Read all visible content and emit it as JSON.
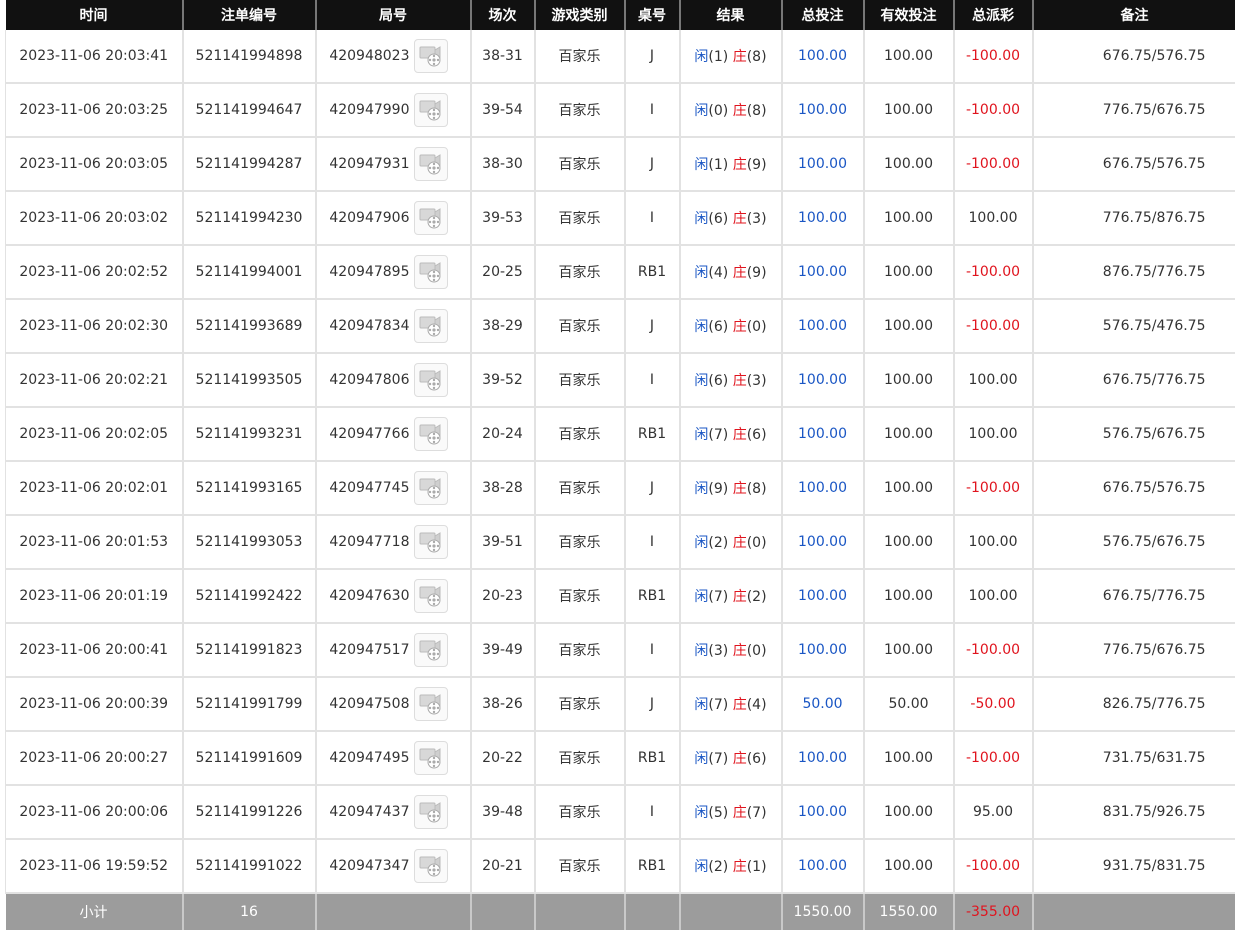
{
  "headers": {
    "time": "时间",
    "order_no": "注单编号",
    "round_no": "局号",
    "session": "场次",
    "game_type": "游戏类别",
    "table": "桌号",
    "result": "结果",
    "total_bet": "总投注",
    "valid_bet": "有效投注",
    "payout": "总派彩",
    "remark": "备注"
  },
  "result_labels": {
    "player": "闲",
    "banker": "庄"
  },
  "rows": [
    {
      "time": "2023-11-06 20:03:41",
      "order": "521141994898",
      "round": "420948023",
      "session": "38-31",
      "game": "百家乐",
      "table": "J",
      "player": "(1)",
      "banker": "(8)",
      "total": "100.00",
      "valid": "100.00",
      "payout": "-100.00",
      "neg": true,
      "remark": "676.75/576.75"
    },
    {
      "time": "2023-11-06 20:03:25",
      "order": "521141994647",
      "round": "420947990",
      "session": "39-54",
      "game": "百家乐",
      "table": "I",
      "player": "(0)",
      "banker": "(8)",
      "total": "100.00",
      "valid": "100.00",
      "payout": "-100.00",
      "neg": true,
      "remark": "776.75/676.75"
    },
    {
      "time": "2023-11-06 20:03:05",
      "order": "521141994287",
      "round": "420947931",
      "session": "38-30",
      "game": "百家乐",
      "table": "J",
      "player": "(1)",
      "banker": "(9)",
      "total": "100.00",
      "valid": "100.00",
      "payout": "-100.00",
      "neg": true,
      "remark": "676.75/576.75"
    },
    {
      "time": "2023-11-06 20:03:02",
      "order": "521141994230",
      "round": "420947906",
      "session": "39-53",
      "game": "百家乐",
      "table": "I",
      "player": "(6)",
      "banker": "(3)",
      "total": "100.00",
      "valid": "100.00",
      "payout": "100.00",
      "neg": false,
      "remark": "776.75/876.75"
    },
    {
      "time": "2023-11-06 20:02:52",
      "order": "521141994001",
      "round": "420947895",
      "session": "20-25",
      "game": "百家乐",
      "table": "RB1",
      "player": "(4)",
      "banker": "(9)",
      "total": "100.00",
      "valid": "100.00",
      "payout": "-100.00",
      "neg": true,
      "remark": "876.75/776.75"
    },
    {
      "time": "2023-11-06 20:02:30",
      "order": "521141993689",
      "round": "420947834",
      "session": "38-29",
      "game": "百家乐",
      "table": "J",
      "player": "(6)",
      "banker": "(0)",
      "total": "100.00",
      "valid": "100.00",
      "payout": "-100.00",
      "neg": true,
      "remark": "576.75/476.75"
    },
    {
      "time": "2023-11-06 20:02:21",
      "order": "521141993505",
      "round": "420947806",
      "session": "39-52",
      "game": "百家乐",
      "table": "I",
      "player": "(6)",
      "banker": "(3)",
      "total": "100.00",
      "valid": "100.00",
      "payout": "100.00",
      "neg": false,
      "remark": "676.75/776.75"
    },
    {
      "time": "2023-11-06 20:02:05",
      "order": "521141993231",
      "round": "420947766",
      "session": "20-24",
      "game": "百家乐",
      "table": "RB1",
      "player": "(7)",
      "banker": "(6)",
      "total": "100.00",
      "valid": "100.00",
      "payout": "100.00",
      "neg": false,
      "remark": "576.75/676.75"
    },
    {
      "time": "2023-11-06 20:02:01",
      "order": "521141993165",
      "round": "420947745",
      "session": "38-28",
      "game": "百家乐",
      "table": "J",
      "player": "(9)",
      "banker": "(8)",
      "total": "100.00",
      "valid": "100.00",
      "payout": "-100.00",
      "neg": true,
      "remark": "676.75/576.75"
    },
    {
      "time": "2023-11-06 20:01:53",
      "order": "521141993053",
      "round": "420947718",
      "session": "39-51",
      "game": "百家乐",
      "table": "I",
      "player": "(2)",
      "banker": "(0)",
      "total": "100.00",
      "valid": "100.00",
      "payout": "100.00",
      "neg": false,
      "remark": "576.75/676.75"
    },
    {
      "time": "2023-11-06 20:01:19",
      "order": "521141992422",
      "round": "420947630",
      "session": "20-23",
      "game": "百家乐",
      "table": "RB1",
      "player": "(7)",
      "banker": "(2)",
      "total": "100.00",
      "valid": "100.00",
      "payout": "100.00",
      "neg": false,
      "remark": "676.75/776.75"
    },
    {
      "time": "2023-11-06 20:00:41",
      "order": "521141991823",
      "round": "420947517",
      "session": "39-49",
      "game": "百家乐",
      "table": "I",
      "player": "(3)",
      "banker": "(0)",
      "total": "100.00",
      "valid": "100.00",
      "payout": "-100.00",
      "neg": true,
      "remark": "776.75/676.75"
    },
    {
      "time": "2023-11-06 20:00:39",
      "order": "521141991799",
      "round": "420947508",
      "session": "38-26",
      "game": "百家乐",
      "table": "J",
      "player": "(7)",
      "banker": "(4)",
      "total": "50.00",
      "valid": "50.00",
      "payout": "-50.00",
      "neg": true,
      "remark": "826.75/776.75"
    },
    {
      "time": "2023-11-06 20:00:27",
      "order": "521141991609",
      "round": "420947495",
      "session": "20-22",
      "game": "百家乐",
      "table": "RB1",
      "player": "(7)",
      "banker": "(6)",
      "total": "100.00",
      "valid": "100.00",
      "payout": "-100.00",
      "neg": true,
      "remark": "731.75/631.75"
    },
    {
      "time": "2023-11-06 20:00:06",
      "order": "521141991226",
      "round": "420947437",
      "session": "39-48",
      "game": "百家乐",
      "table": "I",
      "player": "(5)",
      "banker": "(7)",
      "total": "100.00",
      "valid": "100.00",
      "payout": "95.00",
      "neg": false,
      "remark": "831.75/926.75"
    },
    {
      "time": "2023-11-06 19:59:52",
      "order": "521141991022",
      "round": "420947347",
      "session": "20-21",
      "game": "百家乐",
      "table": "RB1",
      "player": "(2)",
      "banker": "(1)",
      "total": "100.00",
      "valid": "100.00",
      "payout": "-100.00",
      "neg": true,
      "remark": "931.75/831.75"
    }
  ],
  "footer": {
    "label": "小计",
    "count": "16",
    "total_bet": "1550.00",
    "valid_bet": "1550.00",
    "payout": "-355.00"
  },
  "colors": {
    "header_bg": "#111111",
    "footer_bg": "#9c9c9c",
    "blue": "#1a56c4",
    "red": "#e0141e"
  },
  "icons": {
    "replay": "video-replay-icon"
  }
}
